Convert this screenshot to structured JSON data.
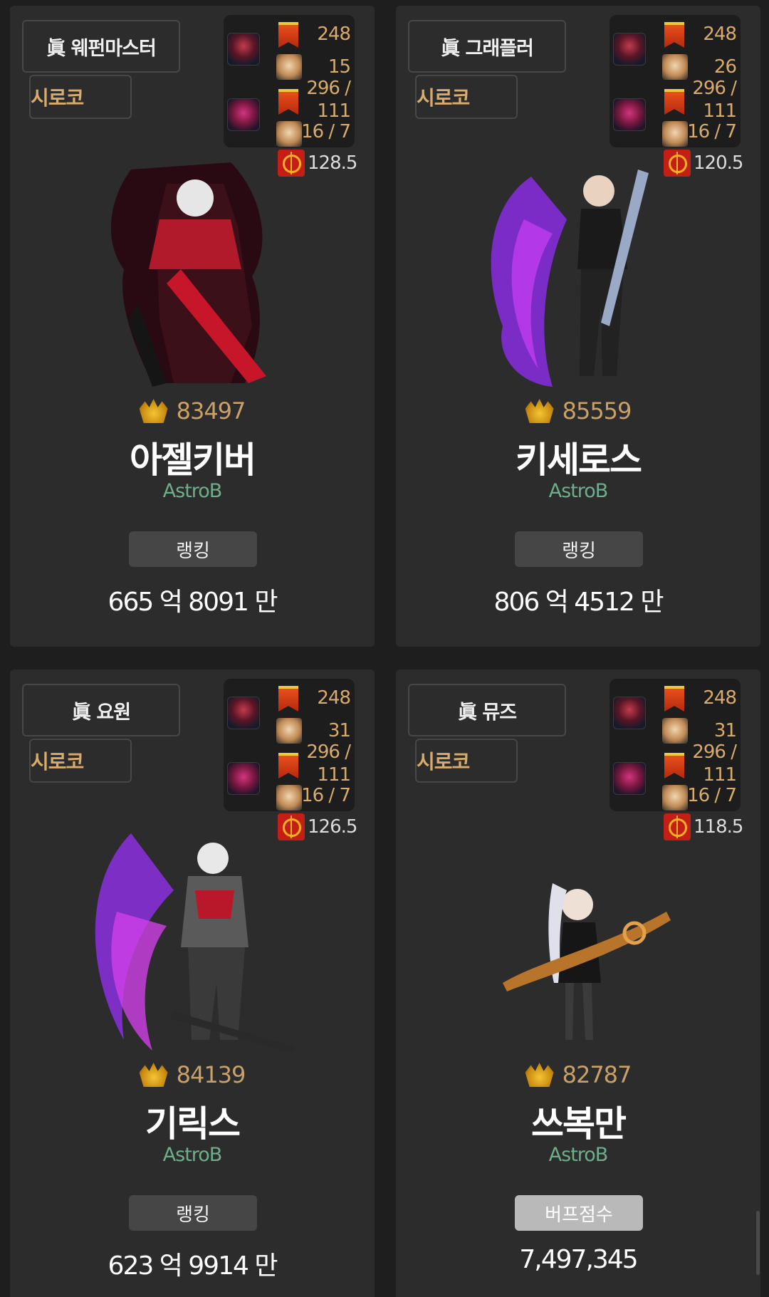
{
  "cards": [
    {
      "job_title": "眞 웨펀마스터",
      "server": "시로코",
      "equip": {
        "level": "248",
        "n1": "15",
        "n2": "296 /",
        "n3": "111",
        "n4": "16 / 7"
      },
      "crit": "128.5",
      "fame": "83497",
      "name": "아젤키버",
      "adventure": "AstroB",
      "button": "랭킹",
      "score": "665 억 8091 만",
      "icons": {
        "weapon": "weapon-emblem-icon",
        "ribbon": "title-ribbon-icon",
        "face": "character-portrait-icon",
        "crit": "crosshair-icon",
        "fame": "fame-crown-icon"
      }
    },
    {
      "job_title": "眞 그래플러",
      "server": "시로코",
      "equip": {
        "level": "248",
        "n1": "26",
        "n2": "296 /",
        "n3": "111",
        "n4": "16 / 7"
      },
      "crit": "120.5",
      "fame": "85559",
      "name": "키세로스",
      "adventure": "AstroB",
      "button": "랭킹",
      "score": "806 억 4512 만",
      "icons": {
        "weapon": "weapon-emblem-icon",
        "ribbon": "title-ribbon-icon",
        "face": "character-portrait-icon",
        "crit": "crosshair-icon",
        "fame": "fame-crown-icon"
      }
    },
    {
      "job_title": "眞 요원",
      "server": "시로코",
      "equip": {
        "level": "248",
        "n1": "31",
        "n2": "296 /",
        "n3": "111",
        "n4": "16 / 7"
      },
      "crit": "126.5",
      "fame": "84139",
      "name": "기릭스",
      "adventure": "AstroB",
      "button": "랭킹",
      "score": "623 억 9914 만",
      "icons": {
        "weapon": "weapon-emblem-icon",
        "ribbon": "title-ribbon-icon",
        "face": "character-portrait-icon",
        "crit": "crosshair-icon",
        "fame": "fame-crown-icon"
      }
    },
    {
      "job_title": "眞 뮤즈",
      "server": "시로코",
      "equip": {
        "level": "248",
        "n1": "31",
        "n2": "296 /",
        "n3": "111",
        "n4": "16 / 7"
      },
      "crit": "118.5",
      "fame": "82787",
      "name": "쓰복만",
      "adventure": "AstroB",
      "button": "버프점수",
      "score": "7,497,345",
      "icons": {
        "weapon": "weapon-emblem-icon",
        "ribbon": "title-ribbon-icon",
        "face": "character-portrait-icon",
        "crit": "crosshair-icon",
        "fame": "fame-crown-icon"
      }
    }
  ]
}
